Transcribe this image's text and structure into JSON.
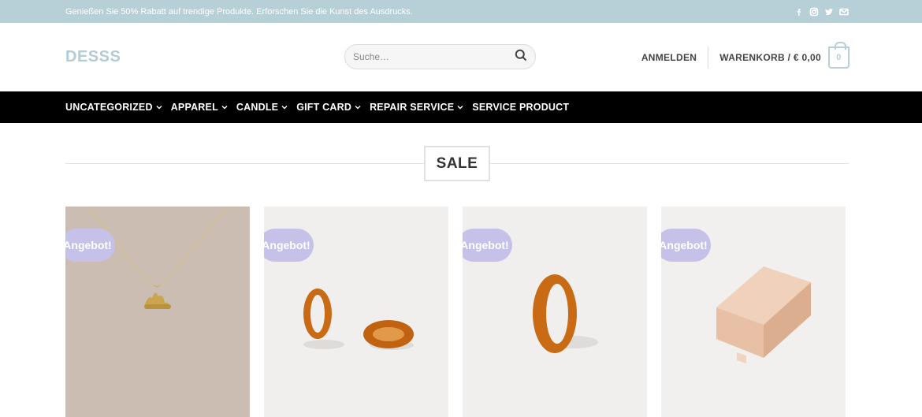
{
  "topbar": {
    "promo": "Genießen Sie 50% Rabatt auf trendige Produkte. Erforschen Sie die Kunst des Ausdrucks.",
    "social_icons": [
      "facebook-icon",
      "instagram-icon",
      "twitter-icon",
      "email-icon"
    ]
  },
  "header": {
    "logo": "DESSS",
    "search_placeholder": "Suche…",
    "login": "ANMELDEN",
    "cart_label": "WARENKORB / € 0,00",
    "cart_count": "0"
  },
  "nav": {
    "items": [
      {
        "label": "UNCATEGORIZED",
        "has_dropdown": true
      },
      {
        "label": "APPAREL",
        "has_dropdown": true
      },
      {
        "label": "CANDLE",
        "has_dropdown": true
      },
      {
        "label": "GIFT CARD",
        "has_dropdown": true
      },
      {
        "label": "REPAIR SERVICE",
        "has_dropdown": true
      },
      {
        "label": "SERVICE PRODUCT",
        "has_dropdown": false
      }
    ]
  },
  "section": {
    "title": "SALE"
  },
  "products": [
    {
      "badge": "Angebot!",
      "image": "gold-necklace-image"
    },
    {
      "badge": "Angebot!",
      "image": "amber-rings-pair-image"
    },
    {
      "badge": "Angebot!",
      "image": "amber-ring-image"
    },
    {
      "badge": "Angebot!",
      "image": "gift-box-image"
    }
  ],
  "colors": {
    "topbar_bg": "#b7d0d8",
    "logo": "#b1ccd7",
    "navbar_bg": "#000000",
    "badge_bg": "#c5c1e8"
  }
}
